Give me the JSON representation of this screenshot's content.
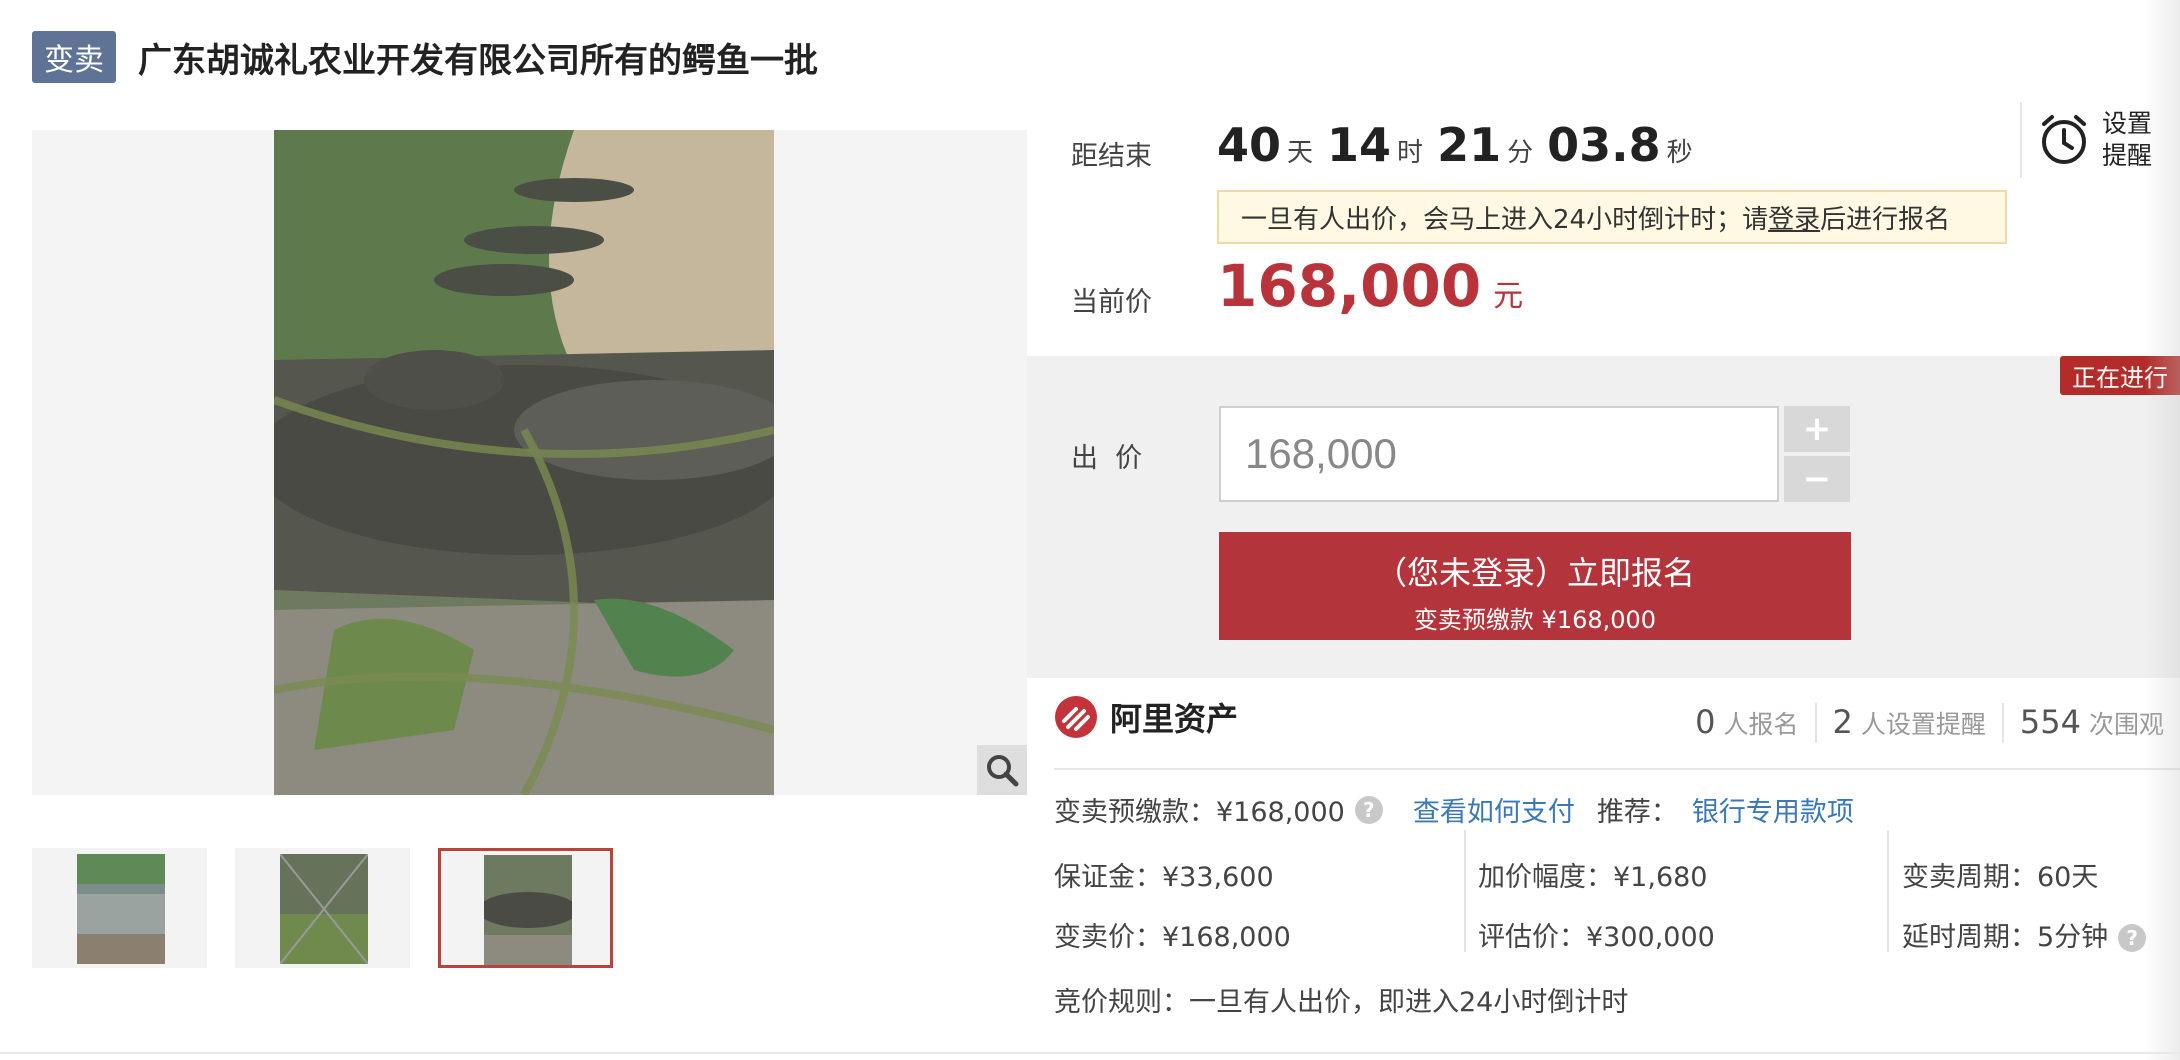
{
  "header": {
    "badge": "变卖",
    "title": "广东胡诚礼农业开发有限公司所有的鳄鱼一批"
  },
  "countdown": {
    "label": "距结束",
    "days": "40",
    "days_unit": "天",
    "hours": "14",
    "hours_unit": "时",
    "minutes": "21",
    "minutes_unit": "分",
    "seconds": "03.8",
    "seconds_unit": "秒",
    "remind_label": "设置提醒"
  },
  "notice": {
    "prefix": "一旦有人出价，会马上进入24小时倒计时；请",
    "login_link": "登录",
    "suffix": "后进行报名"
  },
  "price": {
    "label": "当前价",
    "value": "168,000",
    "unit": "元"
  },
  "bid": {
    "status_badge": "正在进行",
    "label": "出  价",
    "input_value": "168,000",
    "plus": "+",
    "minus": "−",
    "signup_line1": "（您未登录）立即报名",
    "signup_line2": "变卖预缴款 ¥168,000"
  },
  "info": {
    "brand": "阿里资产",
    "stats": [
      {
        "num": "0",
        "label": "人报名"
      },
      {
        "num": "2",
        "label": "人设置提醒"
      },
      {
        "num": "554",
        "label": "次围观"
      }
    ],
    "deposit_text": "变卖预缴款：¥168,000",
    "help_mark": "?",
    "pay_link": "查看如何支付",
    "recommend_label": "推荐：",
    "bank_link": "银行专用款项",
    "items_col1": [
      "保证金：¥33,600",
      "变卖价：¥168,000"
    ],
    "items_col2": [
      "加价幅度：¥1,680",
      "评估价：¥300,000"
    ],
    "items_col3": [
      "变卖周期：60天",
      "延时周期：5分钟"
    ],
    "rule": "竞价规则：一旦有人出价，即进入24小时倒计时"
  },
  "colors": {
    "accent_red": "#b4343b",
    "badge_blue": "#5f7396",
    "link_blue": "#3a78b8"
  },
  "icons": [
    "zoom-icon",
    "alarm-clock-icon",
    "ali-asset-logo-icon",
    "help-icon"
  ]
}
